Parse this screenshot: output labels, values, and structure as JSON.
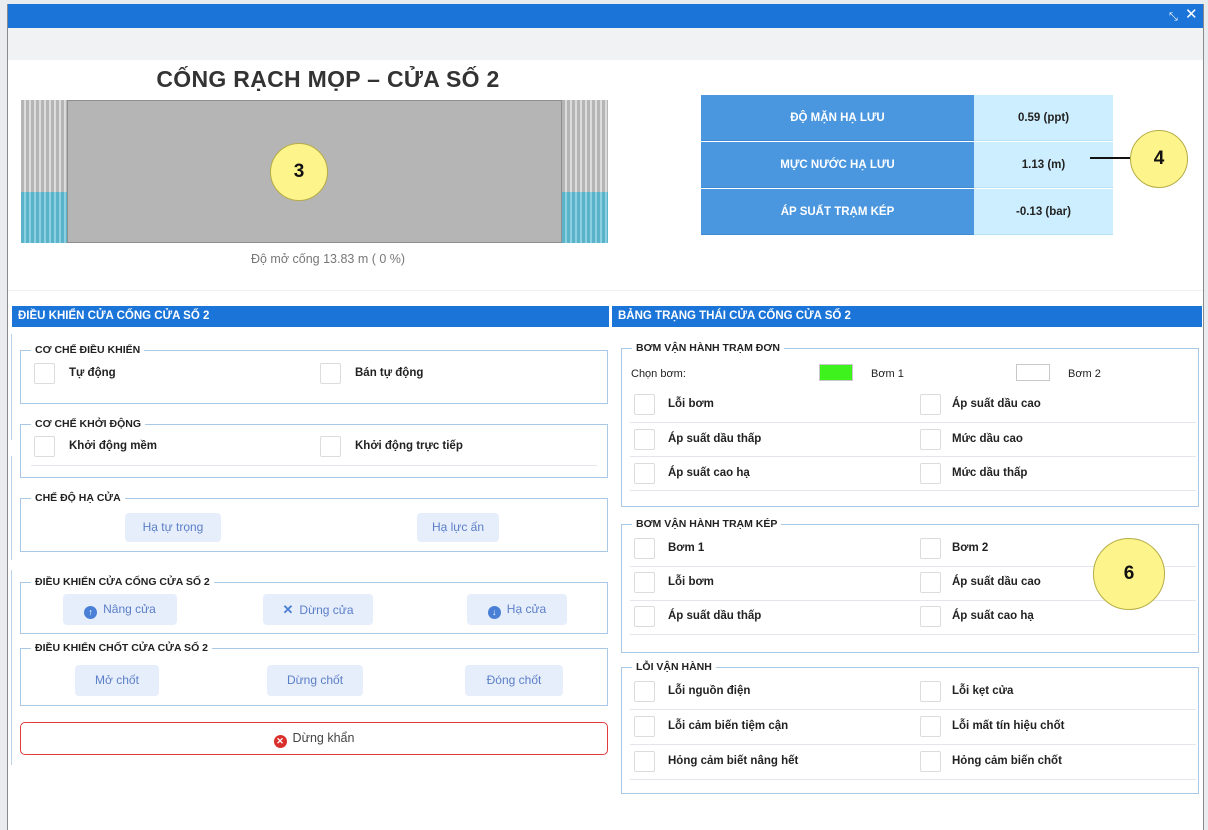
{
  "window": {
    "controls": {
      "minimize": "⤡",
      "close": "✕"
    }
  },
  "gate": {
    "title": "CỐNG RẠCH MỌP – CỬA SỐ 2",
    "opening_text": "Độ mở cống  13.83  m ( 0 %)",
    "opening_percent": 0
  },
  "sensors": [
    {
      "label": "ĐỘ MẶN HẠ LƯU",
      "value": "0.59 (ppt)"
    },
    {
      "label": "MỰC NƯỚC HẠ LƯU",
      "value": "1.13 (m)"
    },
    {
      "label": "ÁP SUẤT TRẠM KÉP",
      "value": "-0.13 (bar)"
    }
  ],
  "callouts": {
    "gate": "3",
    "sensors": "4",
    "status": "6"
  },
  "control": {
    "header": "ĐIỀU KHIỂN CỬA CỐNG CỬA SỐ 2",
    "mechanism": {
      "title": "CƠ CHẾ ĐIỀU KHIỂN",
      "options": [
        "Tự động",
        "Bán tự động"
      ]
    },
    "startup": {
      "title": "CƠ CHẾ KHỞI ĐỘNG",
      "options": [
        "Khởi động mềm",
        "Khởi động trực tiếp"
      ]
    },
    "lowering": {
      "title": "CHẾ ĐỘ HẠ CỬA",
      "buttons": [
        "Hạ tự trọng",
        "Hạ lực ấn"
      ]
    },
    "gate_control": {
      "title": "ĐIỀU KHIỂN CỬA CỐNG CỬA SỐ 2",
      "raise": "Nâng cửa",
      "stop": "Dừng cửa",
      "lower": "Hạ cửa"
    },
    "latch_control": {
      "title": "ĐIỀU KHIỂN CHỐT CỬA CỬA SỐ 2",
      "open": "Mở chốt",
      "stop": "Dừng chốt",
      "close": "Đóng chốt"
    },
    "emergency_stop": "Dừng khẩn"
  },
  "status": {
    "header": "BẢNG TRẠNG THÁI CỬA CỐNG CỬA SỐ 2",
    "single_station": {
      "title": "BƠM VẬN HÀNH TRẠM ĐƠN",
      "choose_label": "Chọn bơm:",
      "pump1": "Bơm 1",
      "pump2": "Bơm 2",
      "pump1_color": "#3df21d",
      "pump2_color": "#ffffff",
      "items": [
        "Lỗi bơm",
        "Áp suất dầu cao",
        "Áp suất dầu thấp",
        "Mức dầu cao",
        "Áp suất cao hạ",
        "Mức dầu thấp"
      ]
    },
    "double_station": {
      "title": "BƠM VẬN HÀNH TRẠM KÉP",
      "items": [
        "Bơm 1",
        "Bơm 2",
        "Lỗi bơm",
        "Áp suất dầu cao",
        "Áp suất dầu thấp",
        "Áp suất cao hạ"
      ]
    },
    "operation_errors": {
      "title": "LỖI VẬN HÀNH",
      "items": [
        "Lỗi nguồn điện",
        "Lỗi kẹt cửa",
        "Lỗi cảm biến tiệm cận",
        "Lỗi mất tín hiệu chốt",
        "Hỏng cảm biết nâng hết",
        "Hỏng cảm biến chốt"
      ]
    }
  },
  "colors": {
    "titlebar": "#1b74d8",
    "section_header": "#1b74d8",
    "sensor_label_bg": "#4a97e0",
    "sensor_value_bg": "#cdeefe",
    "callout": "#fdf48b",
    "estop_border": "#e03c3c"
  }
}
